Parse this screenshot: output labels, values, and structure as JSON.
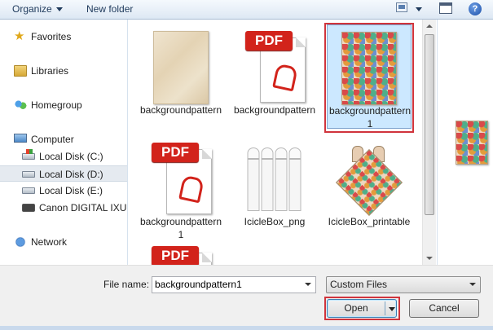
{
  "toolbar": {
    "organize_label": "Organize",
    "new_folder_label": "New folder",
    "help_label": "?"
  },
  "nav": {
    "favorites": "Favorites",
    "libraries": "Libraries",
    "homegroup": "Homegroup",
    "computer": "Computer",
    "drives": [
      {
        "label": "Local Disk (C:)",
        "icon": "windows-drive-icon"
      },
      {
        "label": "Local Disk (D:)",
        "icon": "drive-icon",
        "selected": true
      },
      {
        "label": "Local Disk (E:)",
        "icon": "drive-icon"
      },
      {
        "label": "Canon DIGITAL IXUS",
        "icon": "camera-icon"
      }
    ],
    "network": "Network"
  },
  "files": [
    {
      "name": "backgroundpattern",
      "type": "paper-thumbnail"
    },
    {
      "name": "backgroundpattern",
      "type": "pdf",
      "badge": "PDF"
    },
    {
      "name": "backgroundpattern1",
      "type": "pattern-thumbnail",
      "selected": true
    },
    {
      "name": "backgroundpattern1",
      "type": "pdf",
      "badge": "PDF"
    },
    {
      "name": "IcicleBox_png",
      "type": "box-template-thumbnail"
    },
    {
      "name": "IcicleBox_printable",
      "type": "box-pattern-thumbnail"
    },
    {
      "name": "",
      "type": "pdf",
      "badge": "PDF"
    }
  ],
  "bottom": {
    "file_name_label": "File name:",
    "file_name_value": "backgroundpattern1",
    "filter_value": "Custom Files",
    "open_label": "Open",
    "cancel_label": "Cancel"
  },
  "colors": {
    "highlight_outline": "#d0343c",
    "selection_fill": "#cce8ff",
    "pdf_red": "#d2231b"
  }
}
